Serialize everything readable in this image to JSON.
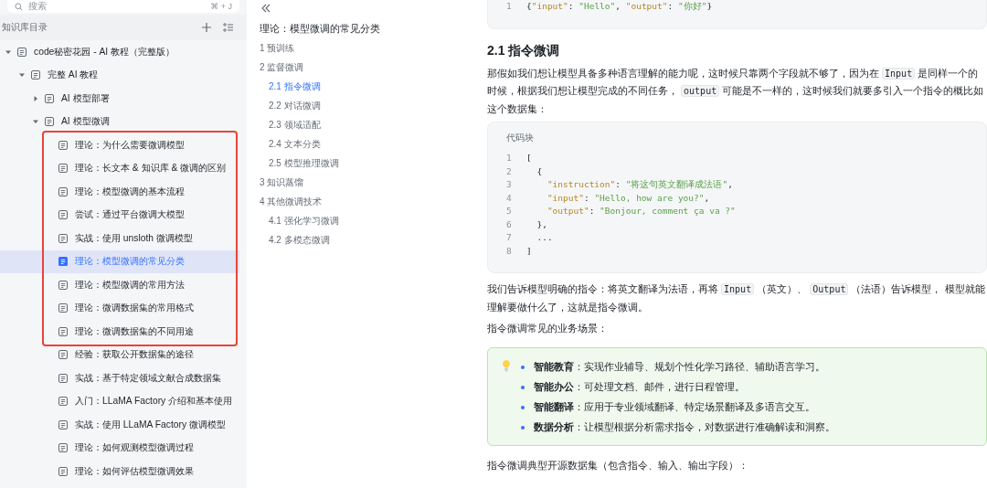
{
  "sidebar": {
    "search": {
      "placeholder": "搜索",
      "shortcut": "⌘ + J"
    },
    "heading": "知识库目录",
    "tree": [
      {
        "label": "code秘密花园 - AI 教程（完整版）",
        "selected": false,
        "expanded": true,
        "children": [
          {
            "label": "完整 AI 教程",
            "selected": false,
            "expanded": true,
            "children": [
              {
                "label": "AI 模型部署",
                "selected": false,
                "expanded": false
              },
              {
                "label": "AI 模型微调",
                "selected": false,
                "expanded": true,
                "children": [
                  {
                    "kind": "highlight",
                    "children": [
                      {
                        "label": "理论：为什么需要微调模型",
                        "selected": false
                      },
                      {
                        "label": "理论：长文本 & 知识库 & 微调的区别",
                        "selected": false
                      },
                      {
                        "label": "理论：模型微调的基本流程",
                        "selected": false
                      },
                      {
                        "label": "尝试：通过平台微调大模型",
                        "selected": false
                      },
                      {
                        "label": "实战：使用 unsloth 微调模型",
                        "selected": false
                      },
                      {
                        "label": "理论：模型微调的常见分类",
                        "selected": true
                      },
                      {
                        "label": "理论：模型微调的常用方法",
                        "selected": false
                      },
                      {
                        "label": "理论：微调数据集的常用格式",
                        "selected": false
                      },
                      {
                        "label": "理论：微调数据集的不同用途",
                        "selected": false
                      }
                    ]
                  },
                  {
                    "label": "经验：获取公开数据集的途径",
                    "selected": false
                  },
                  {
                    "label": "实战：基于特定领域文献合成数据集",
                    "selected": false
                  },
                  {
                    "label": "入门：LLaMA Factory 介绍和基本使用",
                    "selected": false
                  },
                  {
                    "label": "实战：使用 LLaMA Factory 微调模型",
                    "selected": false
                  },
                  {
                    "label": "理论：如何观测模型微调过程",
                    "selected": false
                  },
                  {
                    "label": "理论：如何评估模型微调效果",
                    "selected": false
                  }
                ]
              }
            ]
          }
        ]
      }
    ]
  },
  "toc": {
    "title": "理论：模型微调的常见分类",
    "items": [
      {
        "label": "1 预训练",
        "selected": false
      },
      {
        "label": "2 监督微调",
        "selected": false,
        "children": [
          {
            "label": "2.1 指令微调",
            "selected": true
          },
          {
            "label": "2.2 对话微调",
            "selected": false
          },
          {
            "label": "2.3 领域适配",
            "selected": false
          },
          {
            "label": "2.4 文本分类",
            "selected": false
          },
          {
            "label": "2.5 模型推理微调",
            "selected": false
          }
        ]
      },
      {
        "label": "3 知识蒸馏",
        "selected": false
      },
      {
        "label": "4 其他微调技术",
        "selected": false,
        "children": [
          {
            "label": "4.1 强化学习微调",
            "selected": false
          },
          {
            "label": "4.2 多模态微调",
            "selected": false
          }
        ]
      }
    ]
  },
  "article": {
    "blocks": [
      {
        "kind": "code",
        "lines": [
          {
            "number": "1",
            "tokens": [
              {
                "kind": "punct",
                "text": "{"
              },
              {
                "kind": "key",
                "text": "\"input\""
              },
              {
                "kind": "punct",
                "text": ": "
              },
              {
                "kind": "string",
                "text": "\"Hello\""
              },
              {
                "kind": "punct",
                "text": ", "
              },
              {
                "kind": "key",
                "text": "\"output\""
              },
              {
                "kind": "punct",
                "text": ": "
              },
              {
                "kind": "string",
                "text": "\"你好\""
              },
              {
                "kind": "punct",
                "text": "}"
              }
            ]
          }
        ]
      },
      {
        "kind": "heading",
        "text": "2.1 指令微调"
      },
      {
        "kind": "paragraph",
        "segments": [
          {
            "kind": "text",
            "text": "那假如我们想让模型具备多种语言理解的能力呢，这时候只靠两个字段就不够了，因为在 "
          },
          {
            "kind": "code",
            "text": "Input"
          },
          {
            "kind": "text",
            "text": " 是同样一个的时候，根据我们想让模型完成的不同任务， "
          },
          {
            "kind": "code",
            "text": "output"
          },
          {
            "kind": "text",
            "text": " 可能是不一样的，这时候我们就要多引入一个指令的概比如这个数据集："
          }
        ]
      },
      {
        "kind": "code",
        "label": "代码块",
        "lines": [
          {
            "number": "1",
            "tokens": [
              {
                "kind": "punct",
                "text": "["
              }
            ]
          },
          {
            "number": "2",
            "tokens": [
              {
                "kind": "punct",
                "text": "  {"
              }
            ]
          },
          {
            "number": "3",
            "tokens": [
              {
                "kind": "key",
                "text": "    \"instruction\""
              },
              {
                "kind": "punct",
                "text": ": "
              },
              {
                "kind": "string",
                "text": "\"将这句英文翻译成法语\""
              },
              {
                "kind": "punct",
                "text": ","
              }
            ]
          },
          {
            "number": "4",
            "tokens": [
              {
                "kind": "key",
                "text": "    \"input\""
              },
              {
                "kind": "punct",
                "text": ": "
              },
              {
                "kind": "string",
                "text": "\"Hello, how are you?\""
              },
              {
                "kind": "punct",
                "text": ","
              }
            ]
          },
          {
            "number": "5",
            "tokens": [
              {
                "kind": "key",
                "text": "    \"output\""
              },
              {
                "kind": "punct",
                "text": ": "
              },
              {
                "kind": "string",
                "text": "\"Bonjour, comment ça va ?\""
              }
            ]
          },
          {
            "number": "6",
            "tokens": [
              {
                "kind": "punct",
                "text": "  },"
              }
            ]
          },
          {
            "number": "7",
            "tokens": [
              {
                "kind": "punct",
                "text": "  ..."
              }
            ]
          },
          {
            "number": "8",
            "tokens": [
              {
                "kind": "punct",
                "text": "]"
              }
            ]
          }
        ]
      },
      {
        "kind": "paragraph",
        "segments": [
          {
            "kind": "text",
            "text": "我们告诉模型明确的指令：将英文翻译为法语，再将 "
          },
          {
            "kind": "code",
            "text": "Input"
          },
          {
            "kind": "text",
            "text": " （英文）、 "
          },
          {
            "kind": "code",
            "text": "Output"
          },
          {
            "kind": "text",
            "text": " （法语）告诉模型， 模型就能理解要做什么了，这就是指令微调。"
          }
        ]
      },
      {
        "kind": "paragraph",
        "segments": [
          {
            "kind": "text",
            "text": "指令微调常见的业务场景："
          }
        ]
      },
      {
        "kind": "callout",
        "items": [
          "**智能教育**：实现作业辅导、规划个性化学习路径、辅助语言学习。",
          "**智能办公**：可处理文档、邮件，进行日程管理。",
          "**智能翻译**：应用于专业领域翻译、特定场景翻译及多语言交互。",
          "**数据分析**：让模型根据分析需求指令，对数据进行准确解读和洞察。"
        ]
      },
      {
        "kind": "paragraph",
        "segments": [
          {
            "kind": "text",
            "text": "指令微调典型开源数据集（包含指令、输入、输出字段）："
          }
        ]
      }
    ]
  }
}
